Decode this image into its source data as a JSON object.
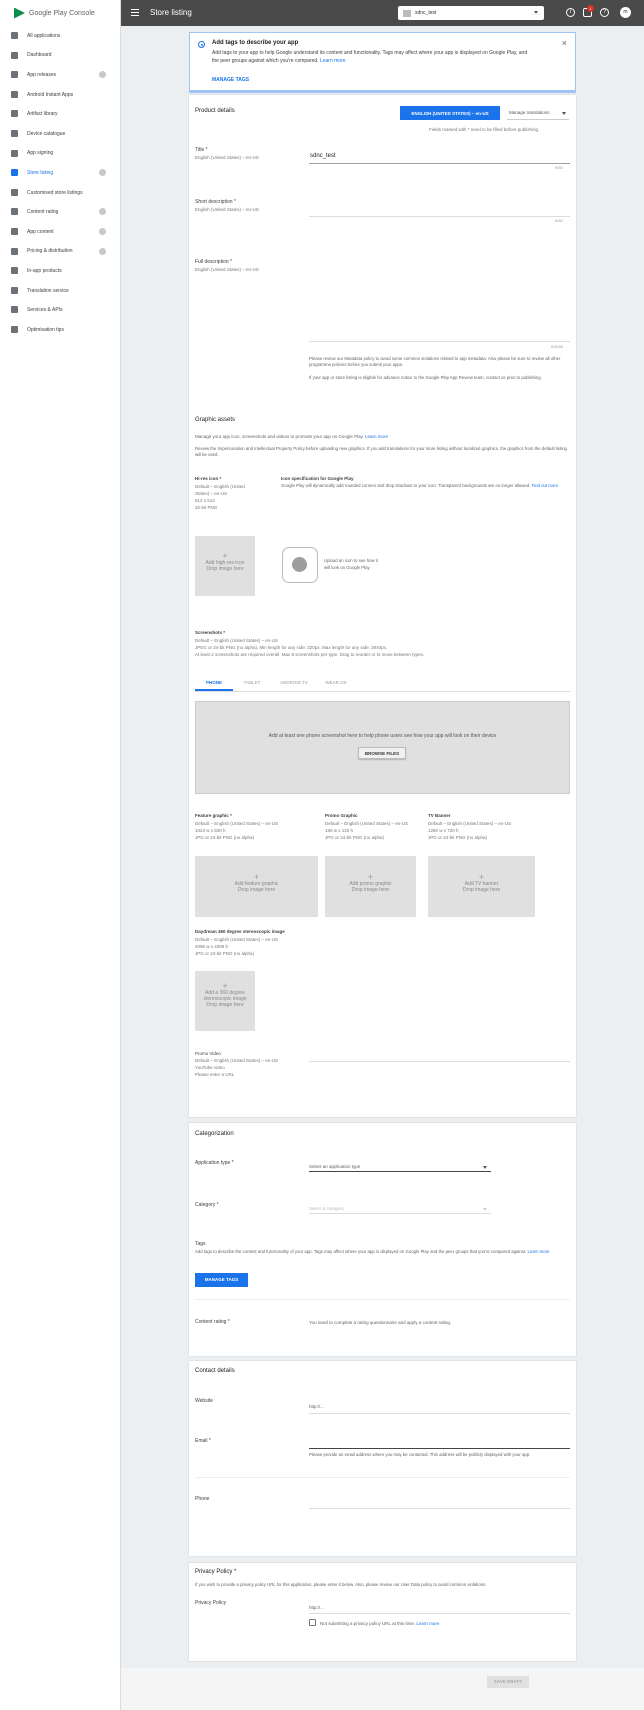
{
  "sidebar": {
    "brand_main": "Google Play",
    "brand_suffix": "Console",
    "items": [
      {
        "label": "All applications"
      },
      {
        "label": "Dashboard"
      },
      {
        "label": "App releases"
      },
      {
        "label": "Android Instant Apps"
      },
      {
        "label": "Artifact library"
      },
      {
        "label": "Device catalogue"
      },
      {
        "label": "App signing"
      },
      {
        "label": "Store listing"
      },
      {
        "label": "Customised store listings"
      },
      {
        "label": "Content rating"
      },
      {
        "label": "App content"
      },
      {
        "label": "Pricing & distribution"
      },
      {
        "label": "In-app products"
      },
      {
        "label": "Translation service"
      },
      {
        "label": "Services & APIs"
      },
      {
        "label": "Optimisation tips"
      }
    ]
  },
  "topbar": {
    "title": "Store listing",
    "app_name": "sdnc_test",
    "notification_count": "1",
    "help_icon": "?",
    "info_icon": "i",
    "avatar_letter": "m"
  },
  "banner": {
    "title": "Add tags to describe your app",
    "body_1": "Add tags to your app to help Google understand its content and functionality. Tags may affect where your app is displayed on Google Play, and the peer groups against which you're compared.",
    "learn_more": "Learn more",
    "action": "MANAGE TAGS",
    "close": "×"
  },
  "product": {
    "heading": "Product details",
    "lang_button": "ENGLISH (UNITED STATES) – en-US",
    "manage_translations": "Manage translations",
    "required_note": "Fields marked with * need to be filled before publishing.",
    "title_label": "Title *",
    "title_locale": "English (United States) – en-US",
    "title_value": "sdnc_test",
    "title_count": "9/50",
    "short_label": "Short description *",
    "short_locale": "English (United States) – en-US",
    "short_count": "0/80",
    "full_label": "Full description *",
    "full_locale": "English (United States) – en-US",
    "full_count": "0/4000",
    "policy_1": "Please review our Metadata policy to avoid some common violations related to app metadata. Also please be sure to review all other programme policies before you submit your apps.",
    "policy_2": "If your app or store listing is eligible for advance notice to the Google Play App Review team, contact us prior to publishing."
  },
  "graphics": {
    "heading": "Graphic assets",
    "intro": "Manage your app icon, screenshots and videos to promote your app on Google Play.",
    "intro_link": "Learn more",
    "review": "Review the Impersonation and Intellectual Property Policy before uploading new graphics. If you add translations for your store listing without localized graphics, the graphics from the default listing will be used.",
    "hires_label": "Hi-res icon *",
    "hires_spec_1": "Default – English (United",
    "hires_spec_2": "States) – en-US",
    "hires_spec_3": "512 x 512",
    "hires_spec_4": "32-bit PNG",
    "icon_spec_title": "Icon specification for Google Play",
    "icon_spec_body": "Google Play will dynamically add rounded corners and drop shadows to your icon. Transparent backgrounds are no longer allowed.",
    "icon_spec_link": "Find out more",
    "hires_drop_1": "Add high-res icon",
    "hires_drop_2": "Drop image here",
    "preview_1": "Upload an icon to see how it",
    "preview_2": "will look on Google Play",
    "screens_label": "Screenshots *",
    "screens_spec_1": "Default – English (United States) – en-US",
    "screens_spec_2": "JPEG or 24-bit PNG (no alpha). Min length for any side: 320px. Max length for any side: 3840px.",
    "screens_spec_3": "At least 2 screenshots are required overall. Max 8 screenshots per type. Drag to reorder or to move between types.",
    "tabs": [
      "PHONE",
      "TABLET",
      "ANDROID TV",
      "WEAR OS"
    ],
    "drop_msg": "Add at least one phone screenshot here to help phone users see how your app will look on their device",
    "browse": "BROWSE FILES",
    "feature_label": "Feature graphic *",
    "feature_spec_1": "Default – English (United States) – en-US",
    "feature_spec_2": "1024 w x 500 h",
    "feature_spec_3": "JPG or 24-bit PNG (no alpha)",
    "promo_label": "Promo Graphic",
    "promo_spec_1": "Default – English (United States) – en-US",
    "promo_spec_2": "180 w x 120 h",
    "promo_spec_3": "JPG or 24-bit PNG (no alpha)",
    "tv_label": "TV Banner",
    "tv_spec_1": "Default – English (United States) – en-US",
    "tv_spec_2": "1280 w x 720 h",
    "tv_spec_3": "JPG or 24-bit PNG (no alpha)",
    "feature_drop_1": "Add feature graphic",
    "feature_drop_2": "Drop image here",
    "promo_drop_1": "Add promo graphic",
    "promo_drop_2": "Drop image here",
    "tv_drop_1": "Add TV banner",
    "tv_drop_2": "Drop image here",
    "daydream_label": "Daydream 360 degree stereoscopic image",
    "daydream_spec_1": "Default – English (United States) – en-US",
    "daydream_spec_2": "4096 w x 4096 h",
    "daydream_spec_3": "JPG or 24-bit PNG (no alpha)",
    "daydream_drop_1": "Add a 360 degree",
    "daydream_drop_2": "stereoscopic image",
    "daydream_drop_3": "Drop image here",
    "video_label": "Promo Video",
    "video_spec_1": "Default – English (United States) – en-US",
    "video_spec_2": "YouTube video",
    "video_spec_3": "Please enter a URL"
  },
  "categorization": {
    "heading": "Categorization",
    "app_type_label": "Application type *",
    "app_type_placeholder": "Select an application type",
    "category_label": "Category *",
    "category_placeholder": "Select a category",
    "tags_label": "Tags",
    "tags_desc": "Add tags to describe the content and functionality of your app. Tags may affect where your app is displayed on Google Play and the peer groups that you're compared against.",
    "tags_link": "Learn more",
    "manage_tags": "MANAGE TAGS",
    "rating_label": "Content rating *",
    "rating_text": "You need to complete a rating questionnaire and apply a content rating."
  },
  "contact": {
    "heading": "Contact details",
    "website_label": "Website",
    "website_placeholder": "http://...",
    "email_label": "Email *",
    "email_help": "Please provide an email address where you may be contacted. This address will be publicly displayed with your app.",
    "phone_label": "Phone"
  },
  "privacy": {
    "heading": "Privacy Policy *",
    "desc": "If you wish to provide a privacy policy URL for this application, please enter it below. Also, please review our User Data policy to avoid common violations.",
    "label": "Privacy Policy",
    "placeholder": "http://...",
    "checkbox": "Not submitting a privacy policy URL at this time.",
    "checkbox_link": "Learn more"
  },
  "footer": {
    "save_draft": "SAVE DRAFT"
  }
}
